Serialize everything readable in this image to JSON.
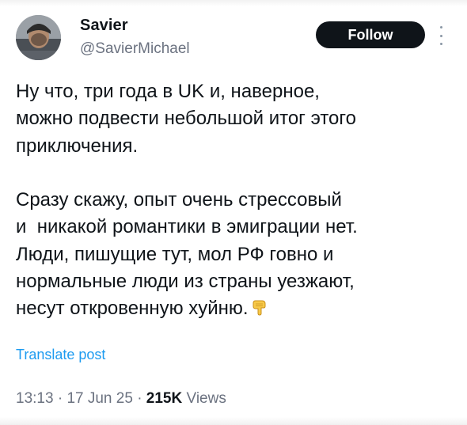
{
  "author": {
    "name": "Savier",
    "handle": "@SavierMichael"
  },
  "follow_button": {
    "label": "Follow"
  },
  "post": {
    "paragraph1": [
      "Ну что, три года в UK и, наверное,",
      "можно подвести небольшой итог этого",
      "приключения."
    ],
    "paragraph2": [
      "Сразу скажу, опыт очень стрессовый",
      "и  никакой романтики в эмиграции нет.",
      "Люди, пишущие тут, мол РФ говно и",
      "нормальные люди из страны уезжают,",
      "несут откровенную хуйню."
    ],
    "emoji": "pointing-down-hand-emoji"
  },
  "translate_link": "Translate post",
  "meta": {
    "time": "13:13",
    "separator": "·",
    "date": "17 Jun 25",
    "views_count": "215K",
    "views_label": "Views"
  },
  "colors": {
    "text": "#0f1419",
    "secondary": "#6b7280",
    "link": "#1d9bf0",
    "button_bg": "#0f1419",
    "button_text": "#ffffff"
  }
}
